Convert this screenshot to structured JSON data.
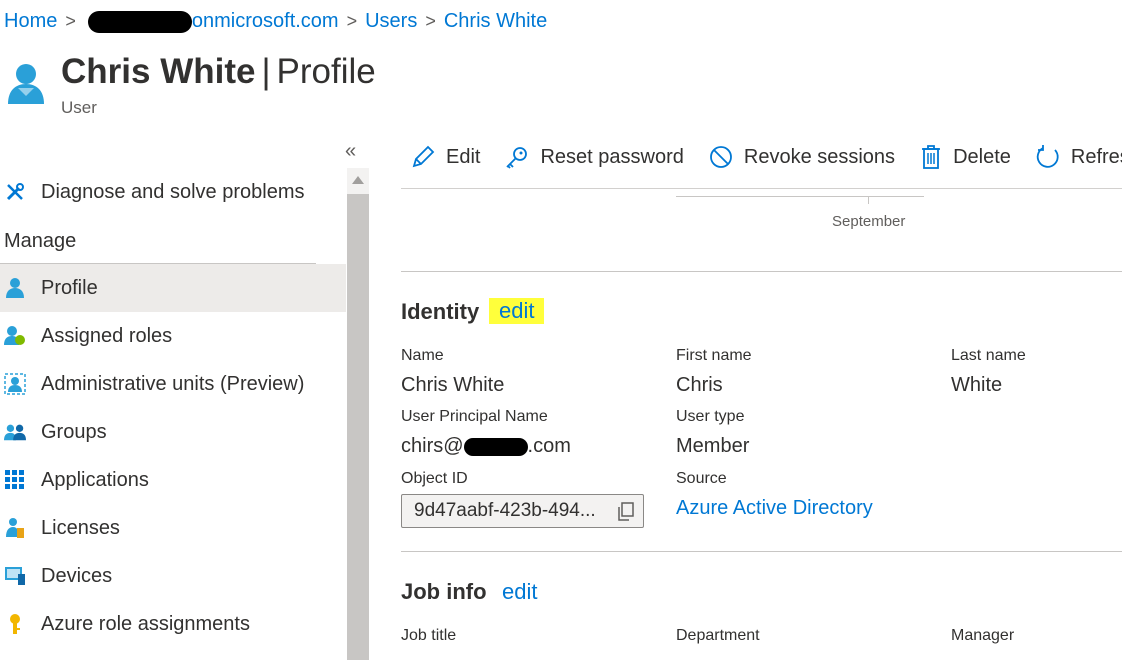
{
  "breadcrumb": {
    "home": "Home",
    "tenant_suffix": "onmicrosoft.com",
    "users": "Users",
    "current": "Chris White"
  },
  "header": {
    "name": "Chris White",
    "separator": "|",
    "page": "Profile",
    "subtitle": "User"
  },
  "sidebar": {
    "collapse": "«",
    "diagnose": "Diagnose and solve problems",
    "manage_heading": "Manage",
    "items": [
      {
        "label": "Profile",
        "icon": "user-icon",
        "active": true
      },
      {
        "label": "Assigned roles",
        "icon": "assigned-roles-icon"
      },
      {
        "label": "Administrative units (Preview)",
        "icon": "admin-units-icon"
      },
      {
        "label": "Groups",
        "icon": "groups-icon"
      },
      {
        "label": "Applications",
        "icon": "applications-grid-icon"
      },
      {
        "label": "Licenses",
        "icon": "licenses-icon"
      },
      {
        "label": "Devices",
        "icon": "devices-icon"
      },
      {
        "label": "Azure role assignments",
        "icon": "key-icon"
      }
    ]
  },
  "toolbar": {
    "edit": "Edit",
    "reset_password": "Reset password",
    "revoke_sessions": "Revoke sessions",
    "delete": "Delete",
    "refresh": "Refresh"
  },
  "chart_fragment": {
    "month_label": "September"
  },
  "identity": {
    "title": "Identity",
    "edit": "edit",
    "name_label": "Name",
    "name_value": "Chris White",
    "first_name_label": "First name",
    "first_name_value": "Chris",
    "last_name_label": "Last name",
    "last_name_value": "White",
    "upn_label": "User Principal Name",
    "upn_prefix": "chirs@",
    "upn_suffix": ".com",
    "user_type_label": "User type",
    "user_type_value": "Member",
    "object_id_label": "Object ID",
    "object_id_value": "9d47aabf-423b-494...",
    "source_label": "Source",
    "source_value": "Azure Active Directory"
  },
  "job_info": {
    "title": "Job info",
    "edit": "edit",
    "job_title_label": "Job title",
    "department_label": "Department",
    "manager_label": "Manager"
  },
  "colors": {
    "accent": "#0078d4",
    "highlight": "#ffff3b",
    "active_bg": "#edebe9"
  }
}
